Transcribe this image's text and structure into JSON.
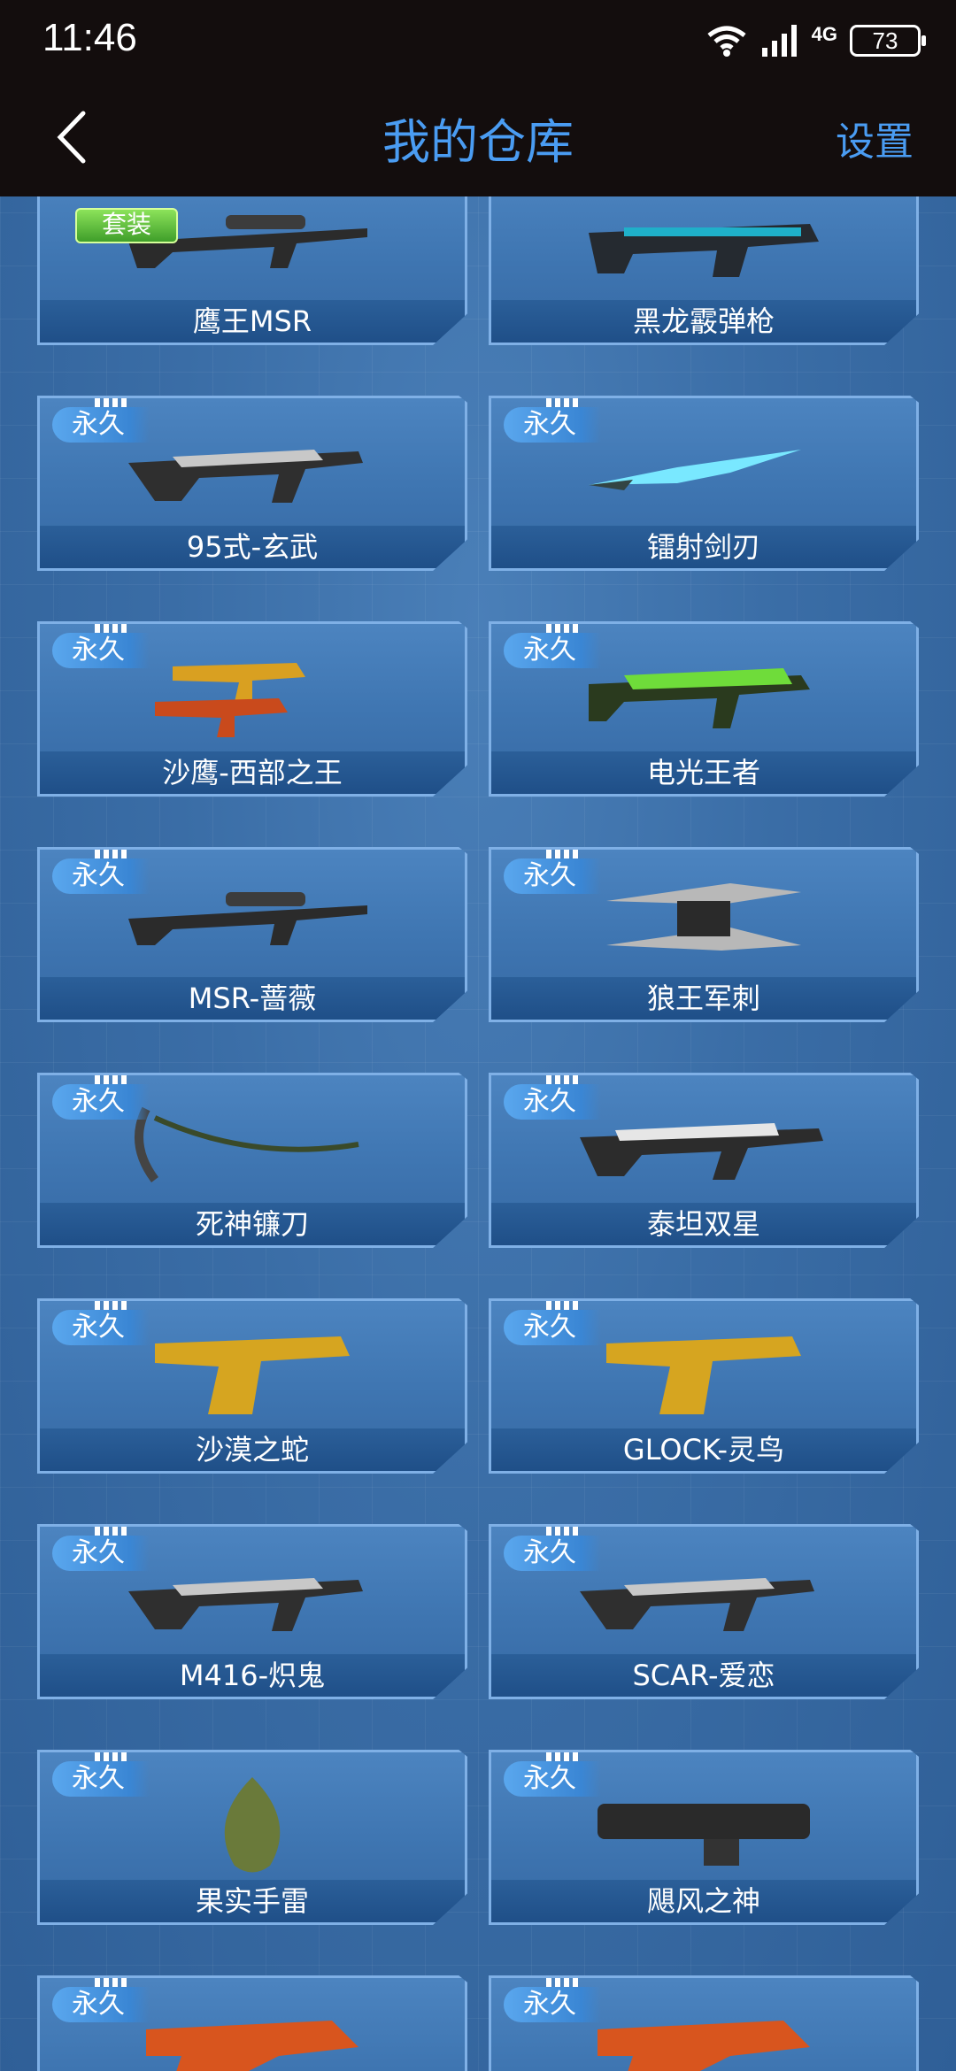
{
  "status_bar": {
    "time": "11:46",
    "network": "4G",
    "battery": "73"
  },
  "nav": {
    "title": "我的仓库",
    "settings": "设置"
  },
  "badge_text": "永久",
  "suit_text": "套装",
  "items": [
    {
      "name": "鹰王MSR",
      "icon": "sniper-rifle-icon"
    },
    {
      "name": "黑龙霰弹枪",
      "icon": "shotgun-icon"
    },
    {
      "name": "95式-玄武",
      "icon": "assault-rifle-icon"
    },
    {
      "name": "镭射剑刃",
      "icon": "laser-blade-icon"
    },
    {
      "name": "沙鹰-西部之王",
      "icon": "dual-pistols-icon"
    },
    {
      "name": "电光王者",
      "icon": "smg-icon"
    },
    {
      "name": "MSR-蔷薇",
      "icon": "sniper-rifle-icon"
    },
    {
      "name": "狼王军刺",
      "icon": "blades-icon"
    },
    {
      "name": "死神镰刀",
      "icon": "scythe-icon"
    },
    {
      "name": "泰坦双星",
      "icon": "rifle-icon"
    },
    {
      "name": "沙漠之蛇",
      "icon": "pistol-icon"
    },
    {
      "name": "GLOCK-灵鸟",
      "icon": "pistol-icon"
    },
    {
      "name": "M416-炽鬼",
      "icon": "assault-rifle-icon"
    },
    {
      "name": "SCAR-爱恋",
      "icon": "assault-rifle-icon"
    },
    {
      "name": "果实手雷",
      "icon": "grenade-icon"
    },
    {
      "name": "飓风之神",
      "icon": "heavy-gun-icon"
    },
    {
      "name": "",
      "icon": "knuckle-blade-icon"
    },
    {
      "name": "",
      "icon": "knuckle-blade-icon"
    }
  ]
}
